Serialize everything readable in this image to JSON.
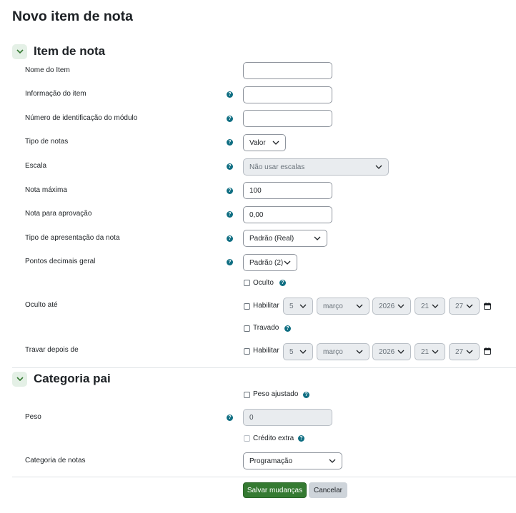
{
  "page": {
    "title": "Novo item de nota"
  },
  "sections": {
    "item": {
      "title": "Item de nota"
    },
    "category": {
      "title": "Categoria pai"
    }
  },
  "fields": {
    "item_name": {
      "label": "Nome do Item",
      "value": ""
    },
    "item_info": {
      "label": "Informação do item",
      "value": ""
    },
    "module_id": {
      "label": "Número de identificação do módulo",
      "value": ""
    },
    "grade_type": {
      "label": "Tipo de notas",
      "value": "Valor"
    },
    "scale": {
      "label": "Escala",
      "value": "Não usar escalas"
    },
    "max_grade": {
      "label": "Nota máxima",
      "value": "100"
    },
    "pass_grade": {
      "label": "Nota para aprovação",
      "value": "0,00"
    },
    "display_type": {
      "label": "Tipo de apresentação da nota",
      "value": "Padrão (Real)"
    },
    "decimals": {
      "label": "Pontos decimais geral",
      "value": "Padrão (2)"
    },
    "hidden": {
      "label": "Oculto"
    },
    "hidden_until": {
      "label": "Oculto até",
      "enable": "Habilitar",
      "day": "5",
      "month": "março",
      "year": "2026",
      "hour": "21",
      "minute": "27"
    },
    "locked": {
      "label": "Travado"
    },
    "lock_after": {
      "label": "Travar depois de",
      "enable": "Habilitar",
      "day": "5",
      "month": "março",
      "year": "2026",
      "hour": "21",
      "minute": "27"
    },
    "weight_adjusted": {
      "label": "Peso ajustado"
    },
    "weight": {
      "label": "Peso",
      "value": "0"
    },
    "extra_credit": {
      "label": "Crédito extra"
    },
    "grade_category": {
      "label": "Categoria de notas",
      "value": "Programação"
    }
  },
  "buttons": {
    "save": "Salvar mudanças",
    "cancel": "Cancelar"
  },
  "colors": {
    "primary": "#357a32",
    "help": "#0f6e82",
    "section_toggle_bg": "#e4f0e6"
  }
}
